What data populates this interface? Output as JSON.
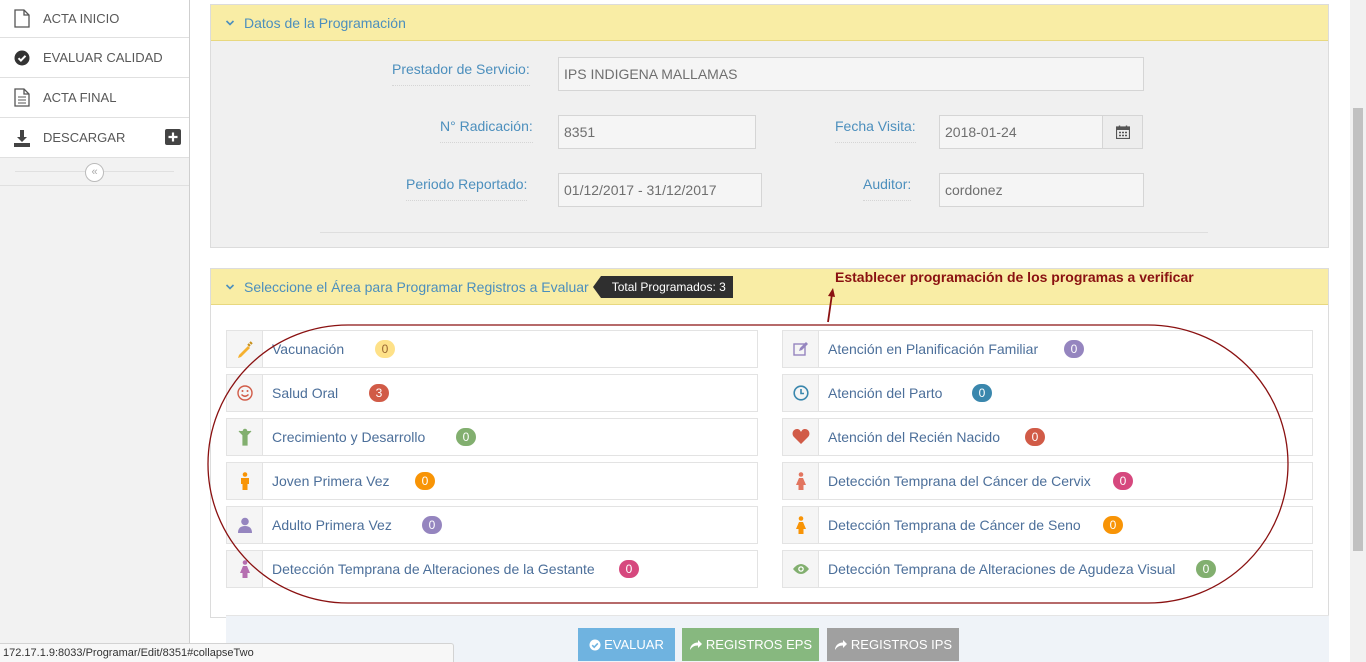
{
  "sidebar": {
    "items": [
      {
        "label": "ACTA INICIO",
        "icon": "document-icon"
      },
      {
        "label": "EVALUAR CALIDAD",
        "icon": "check-circle-icon"
      },
      {
        "label": "ACTA FINAL",
        "icon": "document-text-icon"
      },
      {
        "label": "DESCARGAR",
        "icon": "download-icon"
      }
    ],
    "collapse_glyph": "«"
  },
  "programacion": {
    "title": "Datos de la Programación",
    "prestador_label": "Prestador de Servicio:",
    "prestador_value": "IPS INDIGENA MALLAMAS",
    "radicacion_label": "N° Radicación:",
    "radicacion_value": "8351",
    "fecha_label": "Fecha Visita:",
    "fecha_value": "2018-01-24",
    "periodo_label": "Periodo Reportado:",
    "periodo_value": "01/12/2017 - 31/12/2017",
    "auditor_label": "Auditor:",
    "auditor_value": "cordonez"
  },
  "areas": {
    "title": "Seleccione el Área para Programar Registros a Evaluar",
    "total_badge": "Total Programados: 3",
    "annotation": "Establecer programación de los programas a verificar",
    "left": [
      {
        "label": "Vacunación",
        "count": "0",
        "icon": "syringe-icon",
        "color": "#fee188",
        "text_color": "#963"
      },
      {
        "label": "Salud Oral",
        "count": "3",
        "icon": "smile-icon",
        "color": "#d15b47",
        "text_color": "#fff"
      },
      {
        "label": "Crecimiento y Desarrollo",
        "count": "0",
        "icon": "child-icon",
        "color": "#82af6f",
        "text_color": "#fff"
      },
      {
        "label": "Joven Primera Vez",
        "count": "0",
        "icon": "male-icon",
        "color": "#f89406",
        "text_color": "#fff"
      },
      {
        "label": "Adulto Primera Vez",
        "count": "0",
        "icon": "user-icon",
        "color": "#9585bf",
        "text_color": "#fff"
      },
      {
        "label": "Detección Temprana de Alteraciones de la Gestante",
        "count": "0",
        "icon": "female-icon",
        "color": "#d6487e",
        "text_color": "#fff"
      }
    ],
    "right": [
      {
        "label": "Atención en Planificación Familiar",
        "count": "0",
        "icon": "edit-icon",
        "color": "#9585bf",
        "text_color": "#fff"
      },
      {
        "label": "Atención del Parto",
        "count": "0",
        "icon": "clock-icon",
        "color": "#3a87ad",
        "text_color": "#fff"
      },
      {
        "label": "Atención del Recién Nacido",
        "count": "0",
        "icon": "heart-icon",
        "color": "#d15b47",
        "text_color": "#fff"
      },
      {
        "label": "Detección Temprana del Cáncer de Cervix",
        "count": "0",
        "icon": "female-icon",
        "color": "#d6487e",
        "text_color": "#fff"
      },
      {
        "label": "Detección Temprana de Cáncer de Seno",
        "count": "0",
        "icon": "female-icon",
        "color": "#f89406",
        "text_color": "#fff"
      },
      {
        "label": "Detección Temprana de Alteraciones de Agudeza Visual",
        "count": "0",
        "icon": "eye-icon",
        "color": "#82af6f",
        "text_color": "#fff"
      }
    ]
  },
  "actions": {
    "evaluar": "EVALUAR",
    "registros_eps": "REGISTROS EPS",
    "registros_ips": "REGISTROS IPS"
  },
  "status_url": "172.17.1.9:8033/Programar/Edit/8351#collapseTwo"
}
